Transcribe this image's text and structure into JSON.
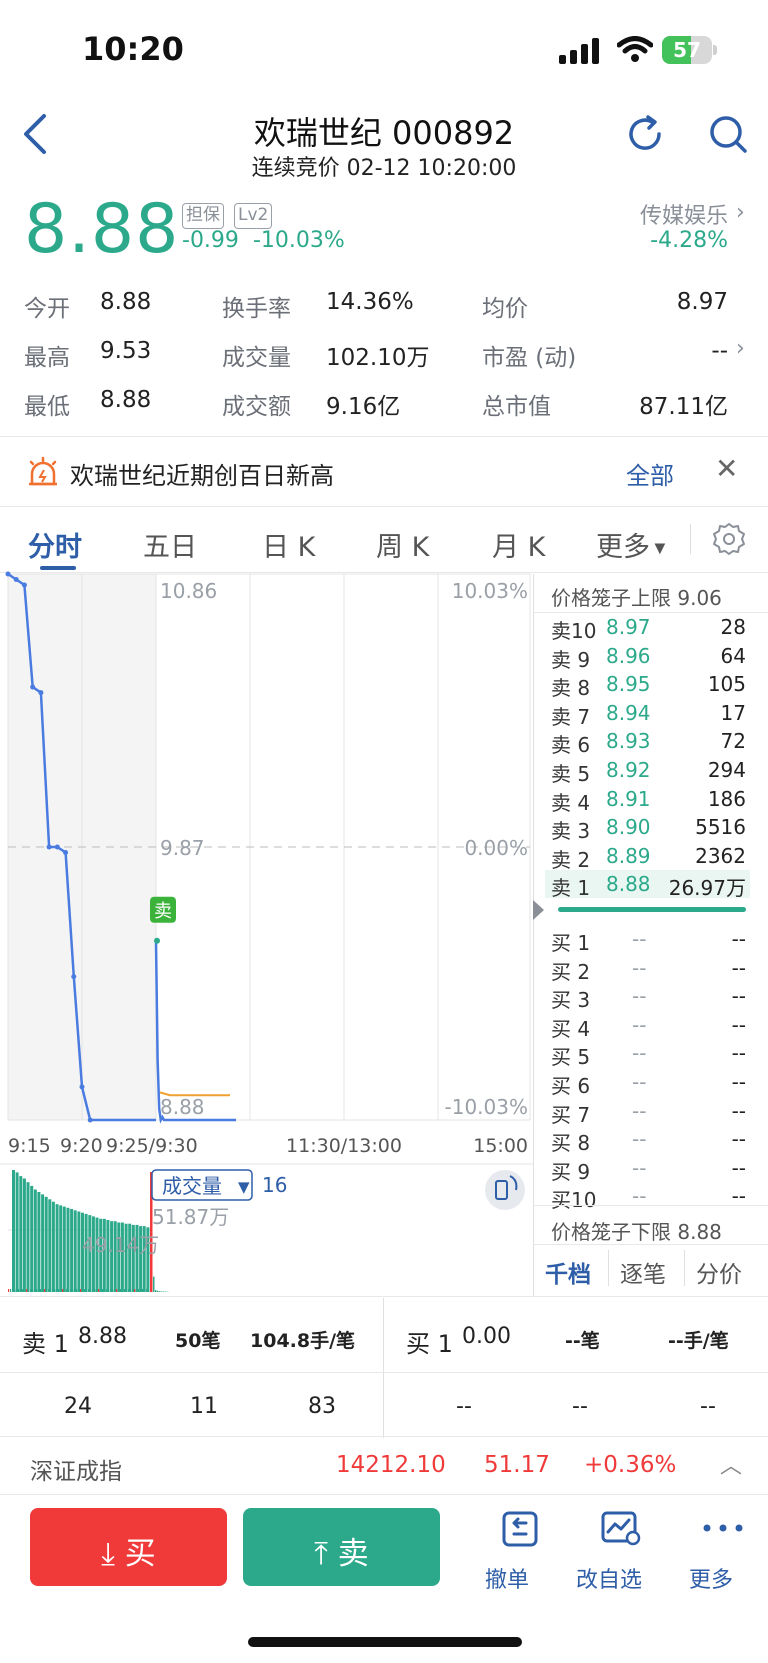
{
  "status_bar": {
    "time": "10:20",
    "battery": "57",
    "battery_level": 0.57
  },
  "header": {
    "title": "欢瑞世纪 000892",
    "subtitle": "连续竞价 02-12 10:20:00"
  },
  "quote": {
    "price": "8.88",
    "tags": [
      "担保",
      "Lv2"
    ],
    "change": "-0.99",
    "change_pct": "-10.03%",
    "sector": {
      "name": "传媒娱乐",
      "change": "-4.28%"
    },
    "stats": {
      "open": {
        "label": "今开",
        "value": "8.88"
      },
      "high": {
        "label": "最高",
        "value": "9.53"
      },
      "low": {
        "label": "最低",
        "value": "8.88"
      },
      "turnover_rate": {
        "label": "换手率",
        "value": "14.36%"
      },
      "volume": {
        "label": "成交量",
        "value": "102.10万"
      },
      "amount": {
        "label": "成交额",
        "value": "9.16亿"
      },
      "avg_price": {
        "label": "均价",
        "value": "8.97"
      },
      "pe": {
        "label": "市盈 (动)",
        "value": "--"
      },
      "market_cap": {
        "label": "总市值",
        "value": "87.11亿"
      }
    }
  },
  "alert": {
    "text": "欢瑞世纪近期创百日新高",
    "action": "全部"
  },
  "tabs": [
    "分时",
    "五日",
    "日 K",
    "周 K",
    "月 K",
    "更多"
  ],
  "chart_data": {
    "type": "line",
    "y_labels": {
      "top": "10.86",
      "mid": "9.87",
      "bottom": "8.88"
    },
    "pct_labels": {
      "top": "10.03%",
      "mid": "0.00%",
      "bottom": "-10.03%"
    },
    "x_labels": [
      "9:15",
      "9:20",
      "9:25/9:30",
      "11:30/13:00",
      "15:00"
    ],
    "ylim": [
      8.88,
      10.86
    ],
    "auction_series": [
      10.86,
      10.84,
      10.82,
      10.45,
      10.43,
      9.87,
      9.87,
      9.85,
      9.4,
      9.0,
      8.88,
      8.88,
      8.88,
      8.88,
      8.88,
      8.88,
      8.88,
      8.88,
      8.88
    ],
    "trade_series": [
      9.53,
      9.1,
      8.92,
      8.88,
      8.89,
      8.88,
      8.88,
      8.88,
      8.88,
      8.88,
      8.88
    ],
    "avg_series": [
      8.98,
      8.97,
      8.97,
      8.97,
      8.97,
      8.97,
      8.97,
      8.97
    ],
    "sell_marker": "卖",
    "volume_panel": {
      "label": "成交量",
      "value": "16",
      "max_label": "51.87万",
      "auction_max_label": "49.14万",
      "auction_bars": [
        1.0,
        0.98,
        0.95,
        0.93,
        0.9,
        0.87,
        0.84,
        0.82,
        0.8,
        0.78,
        0.76,
        0.74,
        0.72,
        0.71,
        0.7,
        0.69,
        0.68,
        0.67,
        0.66,
        0.65,
        0.64,
        0.63,
        0.62,
        0.61,
        0.6,
        0.6,
        0.59,
        0.58,
        0.58,
        0.57,
        0.57,
        0.56,
        0.56,
        0.55,
        0.55,
        0.54,
        0.54,
        0.53
      ],
      "trade_bars": [
        1.0,
        0.12,
        0.08,
        0.05,
        0.04,
        0.03,
        0.03,
        0.02
      ]
    }
  },
  "order_book": {
    "upper_limit": "价格笼子上限 9.06",
    "lower_limit": "价格笼子下限 8.88",
    "asks": [
      {
        "label": "卖10",
        "price": "8.97",
        "vol": "28"
      },
      {
        "label": "卖 9",
        "price": "8.96",
        "vol": "64"
      },
      {
        "label": "卖 8",
        "price": "8.95",
        "vol": "105"
      },
      {
        "label": "卖 7",
        "price": "8.94",
        "vol": "17"
      },
      {
        "label": "卖 6",
        "price": "8.93",
        "vol": "72"
      },
      {
        "label": "卖 5",
        "price": "8.92",
        "vol": "294"
      },
      {
        "label": "卖 4",
        "price": "8.91",
        "vol": "186"
      },
      {
        "label": "卖 3",
        "price": "8.90",
        "vol": "5516"
      },
      {
        "label": "卖 2",
        "price": "8.89",
        "vol": "2362"
      },
      {
        "label": "卖 1",
        "price": "8.88",
        "vol": "26.97万"
      }
    ],
    "bids": [
      {
        "label": "买 1",
        "price": "--",
        "vol": "--"
      },
      {
        "label": "买 2",
        "price": "--",
        "vol": "--"
      },
      {
        "label": "买 3",
        "price": "--",
        "vol": "--"
      },
      {
        "label": "买 4",
        "price": "--",
        "vol": "--"
      },
      {
        "label": "买 5",
        "price": "--",
        "vol": "--"
      },
      {
        "label": "买 6",
        "price": "--",
        "vol": "--"
      },
      {
        "label": "买 7",
        "price": "--",
        "vol": "--"
      },
      {
        "label": "买 8",
        "price": "--",
        "vol": "--"
      },
      {
        "label": "买 9",
        "price": "--",
        "vol": "--"
      },
      {
        "label": "买10",
        "price": "--",
        "vol": "--"
      }
    ],
    "tabs": [
      "千档",
      "逐笔",
      "分价"
    ]
  },
  "trade_summary": {
    "sell": {
      "label": "卖 1",
      "price": "8.88",
      "orders": "50笔",
      "per_order": "104.8手/笔",
      "queue": [
        "24",
        "11",
        "83"
      ]
    },
    "buy": {
      "label": "买 1",
      "price": "0.00",
      "orders": "--笔",
      "per_order": "--手/笔",
      "queue": [
        "--",
        "--",
        "--"
      ]
    }
  },
  "index_bar": {
    "name": "深证成指",
    "value": "14212.10",
    "change": "51.17",
    "change_pct": "+0.36%"
  },
  "actions": {
    "buy": "买",
    "sell": "卖",
    "cancel": "撤单",
    "edit_watchlist": "改自选",
    "more": "更多"
  },
  "colors": {
    "up": "#f03a3a",
    "down": "#2ba98a",
    "accent": "#2f5ea8",
    "line": "#4a7be0",
    "avg": "#f0a030"
  }
}
